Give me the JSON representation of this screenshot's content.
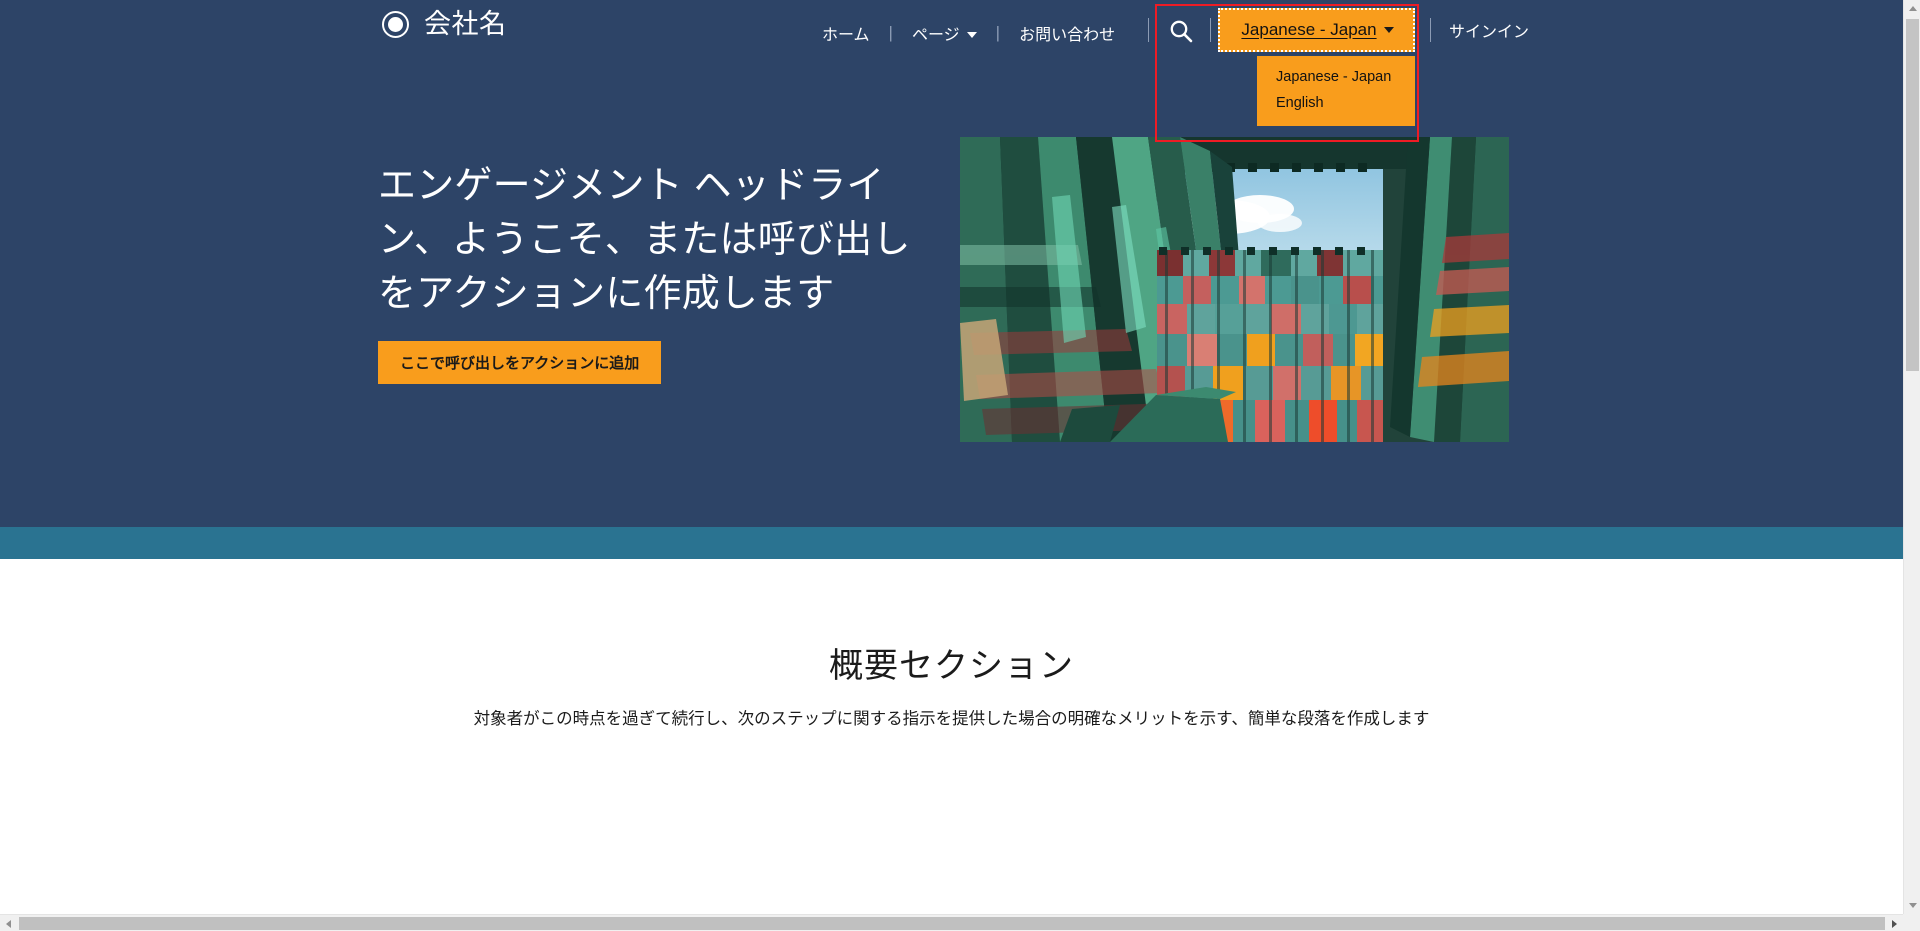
{
  "site": {
    "brand_name": "会社名",
    "logo_icon": "circle-target-icon"
  },
  "nav": {
    "links": [
      {
        "label": "ホーム",
        "has_caret": false
      },
      {
        "label": "ページ",
        "has_caret": true
      },
      {
        "label": "お問い合わせ",
        "has_caret": false
      }
    ],
    "separator": "|",
    "search_icon": "search-icon",
    "signin_label": "サインイン"
  },
  "language_selector": {
    "selected": "Japanese - Japan",
    "caret_icon": "chevron-down-icon",
    "open": true,
    "options": [
      "Japanese - Japan",
      "English"
    ]
  },
  "hero": {
    "title": "エンゲージメント ヘッドライン、ようこそ、または呼び出しをアクションに作成します",
    "cta_label": "ここで呼び出しをアクションに追加",
    "image_alt": "カラフルな輸送コンテナの壁と空"
  },
  "overview": {
    "title": "概要セクション",
    "text": "対象者がこの時点を過ぎて続行し、次のステップに関する指示を提供した場合の明確なメリットを示す、簡単な段落を作成します"
  },
  "colors": {
    "navy": "#2d4467",
    "teal": "#2a7391",
    "accent_orange": "#f99d1c",
    "annotation_red": "#ee1c25",
    "text_light": "#ffffff",
    "text_dark": "#1b1b1b"
  },
  "annotation": {
    "type": "highlight-box",
    "target": "language-selector"
  },
  "scrollbars": {
    "vertical_present": true,
    "horizontal_present": true
  }
}
